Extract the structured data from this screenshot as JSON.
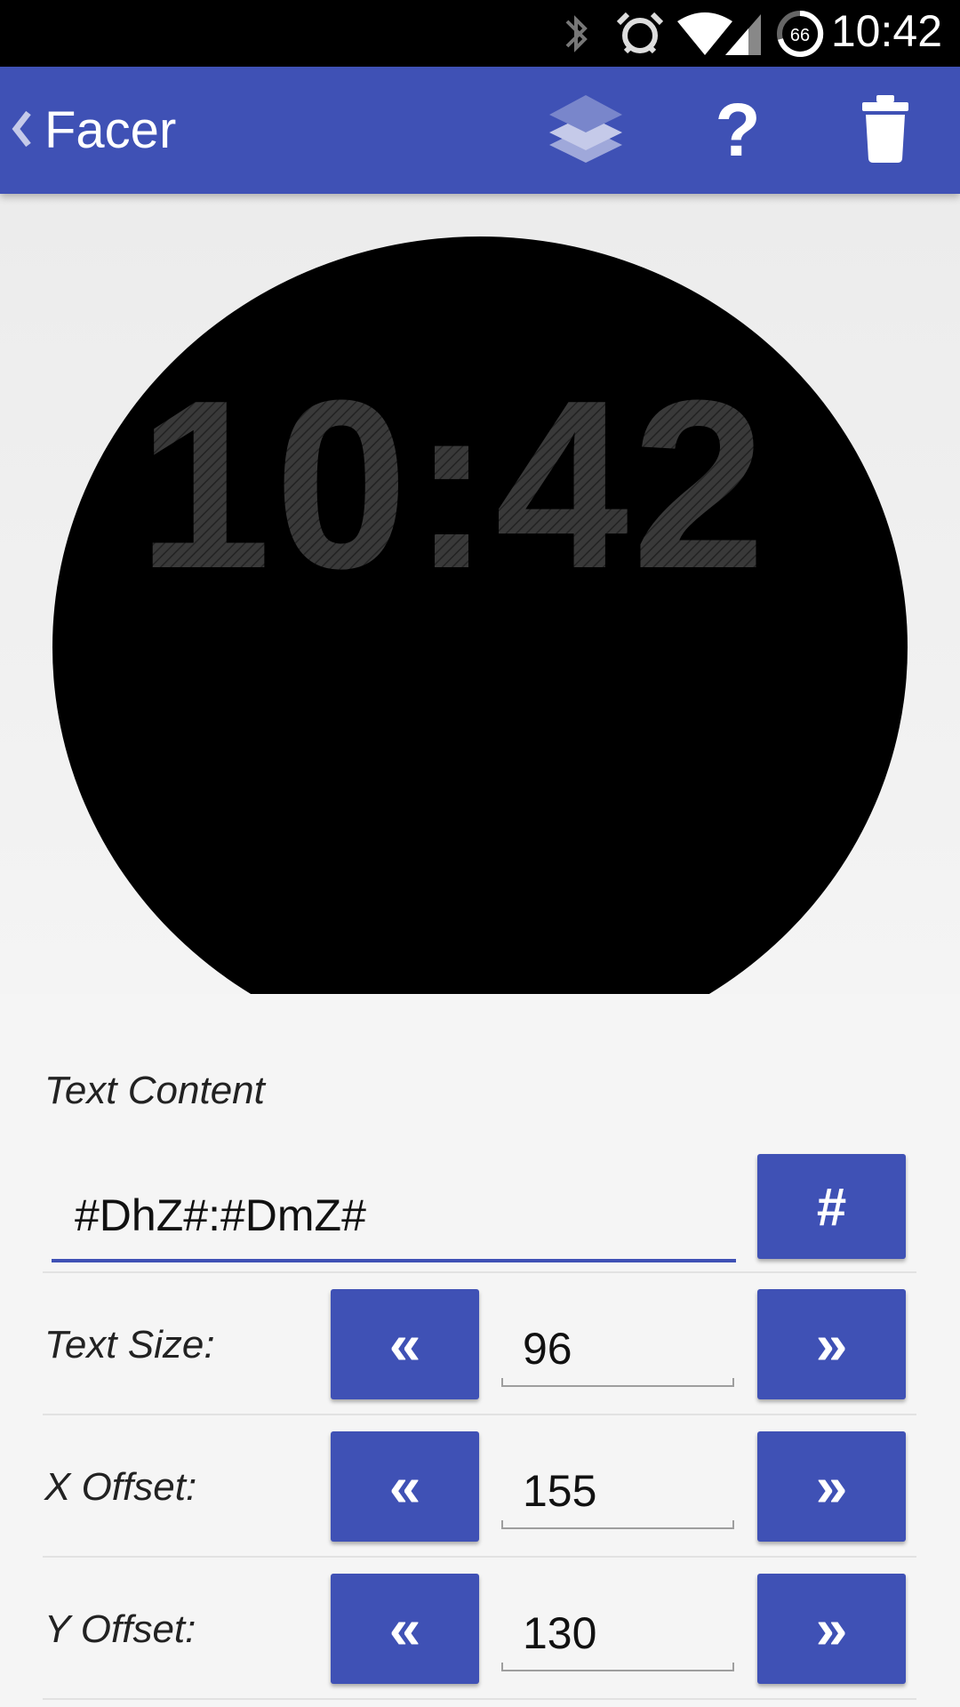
{
  "status_bar": {
    "time": "10:42",
    "battery_level": "66",
    "icons": [
      "bluetooth-icon",
      "alarm-icon",
      "wifi-icon",
      "signal-icon",
      "battery-icon"
    ]
  },
  "app_bar": {
    "title": "Facer",
    "back_icon": "chevron-left-icon",
    "actions": [
      "layers-icon",
      "help-icon",
      "trash-icon"
    ],
    "color": "#3f51b5"
  },
  "preview": {
    "watch_time": "10:42",
    "face_color": "#000000",
    "digit_color": "#3a3a3a"
  },
  "editor": {
    "text_content_label": "Text Content",
    "text_content_value": "#DhZ#:#DmZ#",
    "hash_button_label": "#",
    "rows": [
      {
        "label": "Text Size:",
        "value": "96",
        "dec": "«",
        "inc": "»"
      },
      {
        "label": "X Offset:",
        "value": "155",
        "dec": "«",
        "inc": "»"
      },
      {
        "label": "Y Offset:",
        "value": "130",
        "dec": "«",
        "inc": "»"
      }
    ]
  }
}
